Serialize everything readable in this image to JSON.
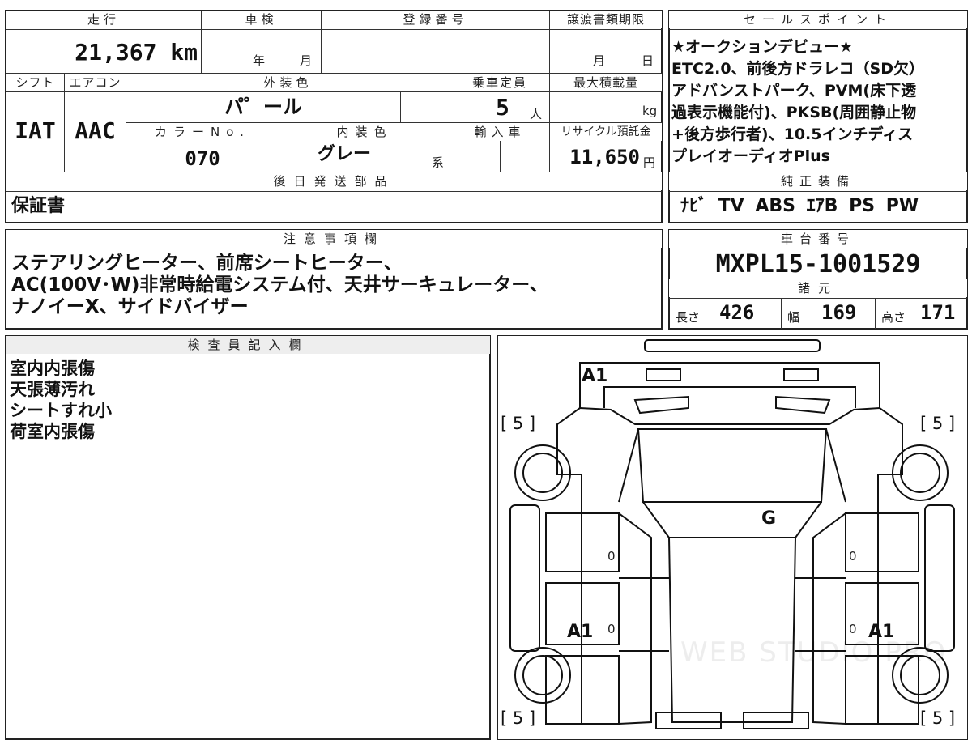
{
  "main_table": {
    "mileage_label": "走行",
    "mileage_value": "21,367 km",
    "inspection_label": "車検",
    "inspection_year": "年",
    "inspection_month": "月",
    "registration_label": "登録番号",
    "transfer_label": "譲渡書類期限",
    "transfer_month": "月",
    "transfer_day": "日",
    "shift_label": "シフト",
    "shift_value": "IAT",
    "ac_label": "エアコン",
    "ac_value": "AAC",
    "exterior_label": "外装色",
    "exterior_value": "パ゜ール",
    "capacity_label": "乗車定員",
    "capacity_value": "5",
    "capacity_unit": "人",
    "maxload_label": "最大積載量",
    "maxload_unit": "kg",
    "colorno_label": "カラーNo.",
    "colorno_value": "070",
    "interior_label": "内装色",
    "interior_value": "グレー",
    "interior_suffix": "系",
    "import_label": "輸入車",
    "recycle_label": "リサイクル預託金",
    "recycle_value": "11,650",
    "recycle_unit": "円",
    "later_parts_label": "後日発送部品",
    "later_parts_value": "保証書"
  },
  "sales_points": {
    "label": "セールスポイント",
    "lines": [
      "★オークションデビュー★",
      "ETC2.0、前後方ドラレコ（SD欠）",
      "アドバンストパーク、PVM(床下透",
      "過表示機能付)、PKSB(周囲静止物",
      "+後方歩行者)、10.5インチディス",
      "プレイオーディオPlus"
    ]
  },
  "genuine_equipment": {
    "label": "純正装備",
    "value": "ﾅﾋﾞ TV ABS ｴｱB PS PW"
  },
  "notes": {
    "label": "注意事項欄",
    "lines": [
      "ステアリングヒーター、前席シートヒーター、",
      "AC(100V･W)非常時給電システム付、天井サーキュレーター、",
      "ナノイーX、サイドバイザー"
    ]
  },
  "chassis": {
    "label": "車台番号",
    "value": "MXPL15-1001529"
  },
  "specs": {
    "label": "諸元",
    "length_label": "長さ",
    "length_value": "426",
    "width_label": "幅",
    "width_value": "169",
    "height_label": "高さ",
    "height_value": "171"
  },
  "inspector": {
    "label": "検査員記入欄",
    "lines": [
      "室内内張傷",
      "天張薄汚れ",
      "シートすれ小",
      "荷室内張傷"
    ]
  },
  "diagram": {
    "marks": {
      "front_bumper": "A1",
      "windshield": "G",
      "rear_left": "A1",
      "rear_right": "A1",
      "tire_fl": "[ 5 ]",
      "tire_fr": "[ 5 ]",
      "tire_rl": "[ 5 ]",
      "tire_rr": "[ 5 ]",
      "zero": "0"
    },
    "watermark": "WEB STUDIO PRO"
  }
}
